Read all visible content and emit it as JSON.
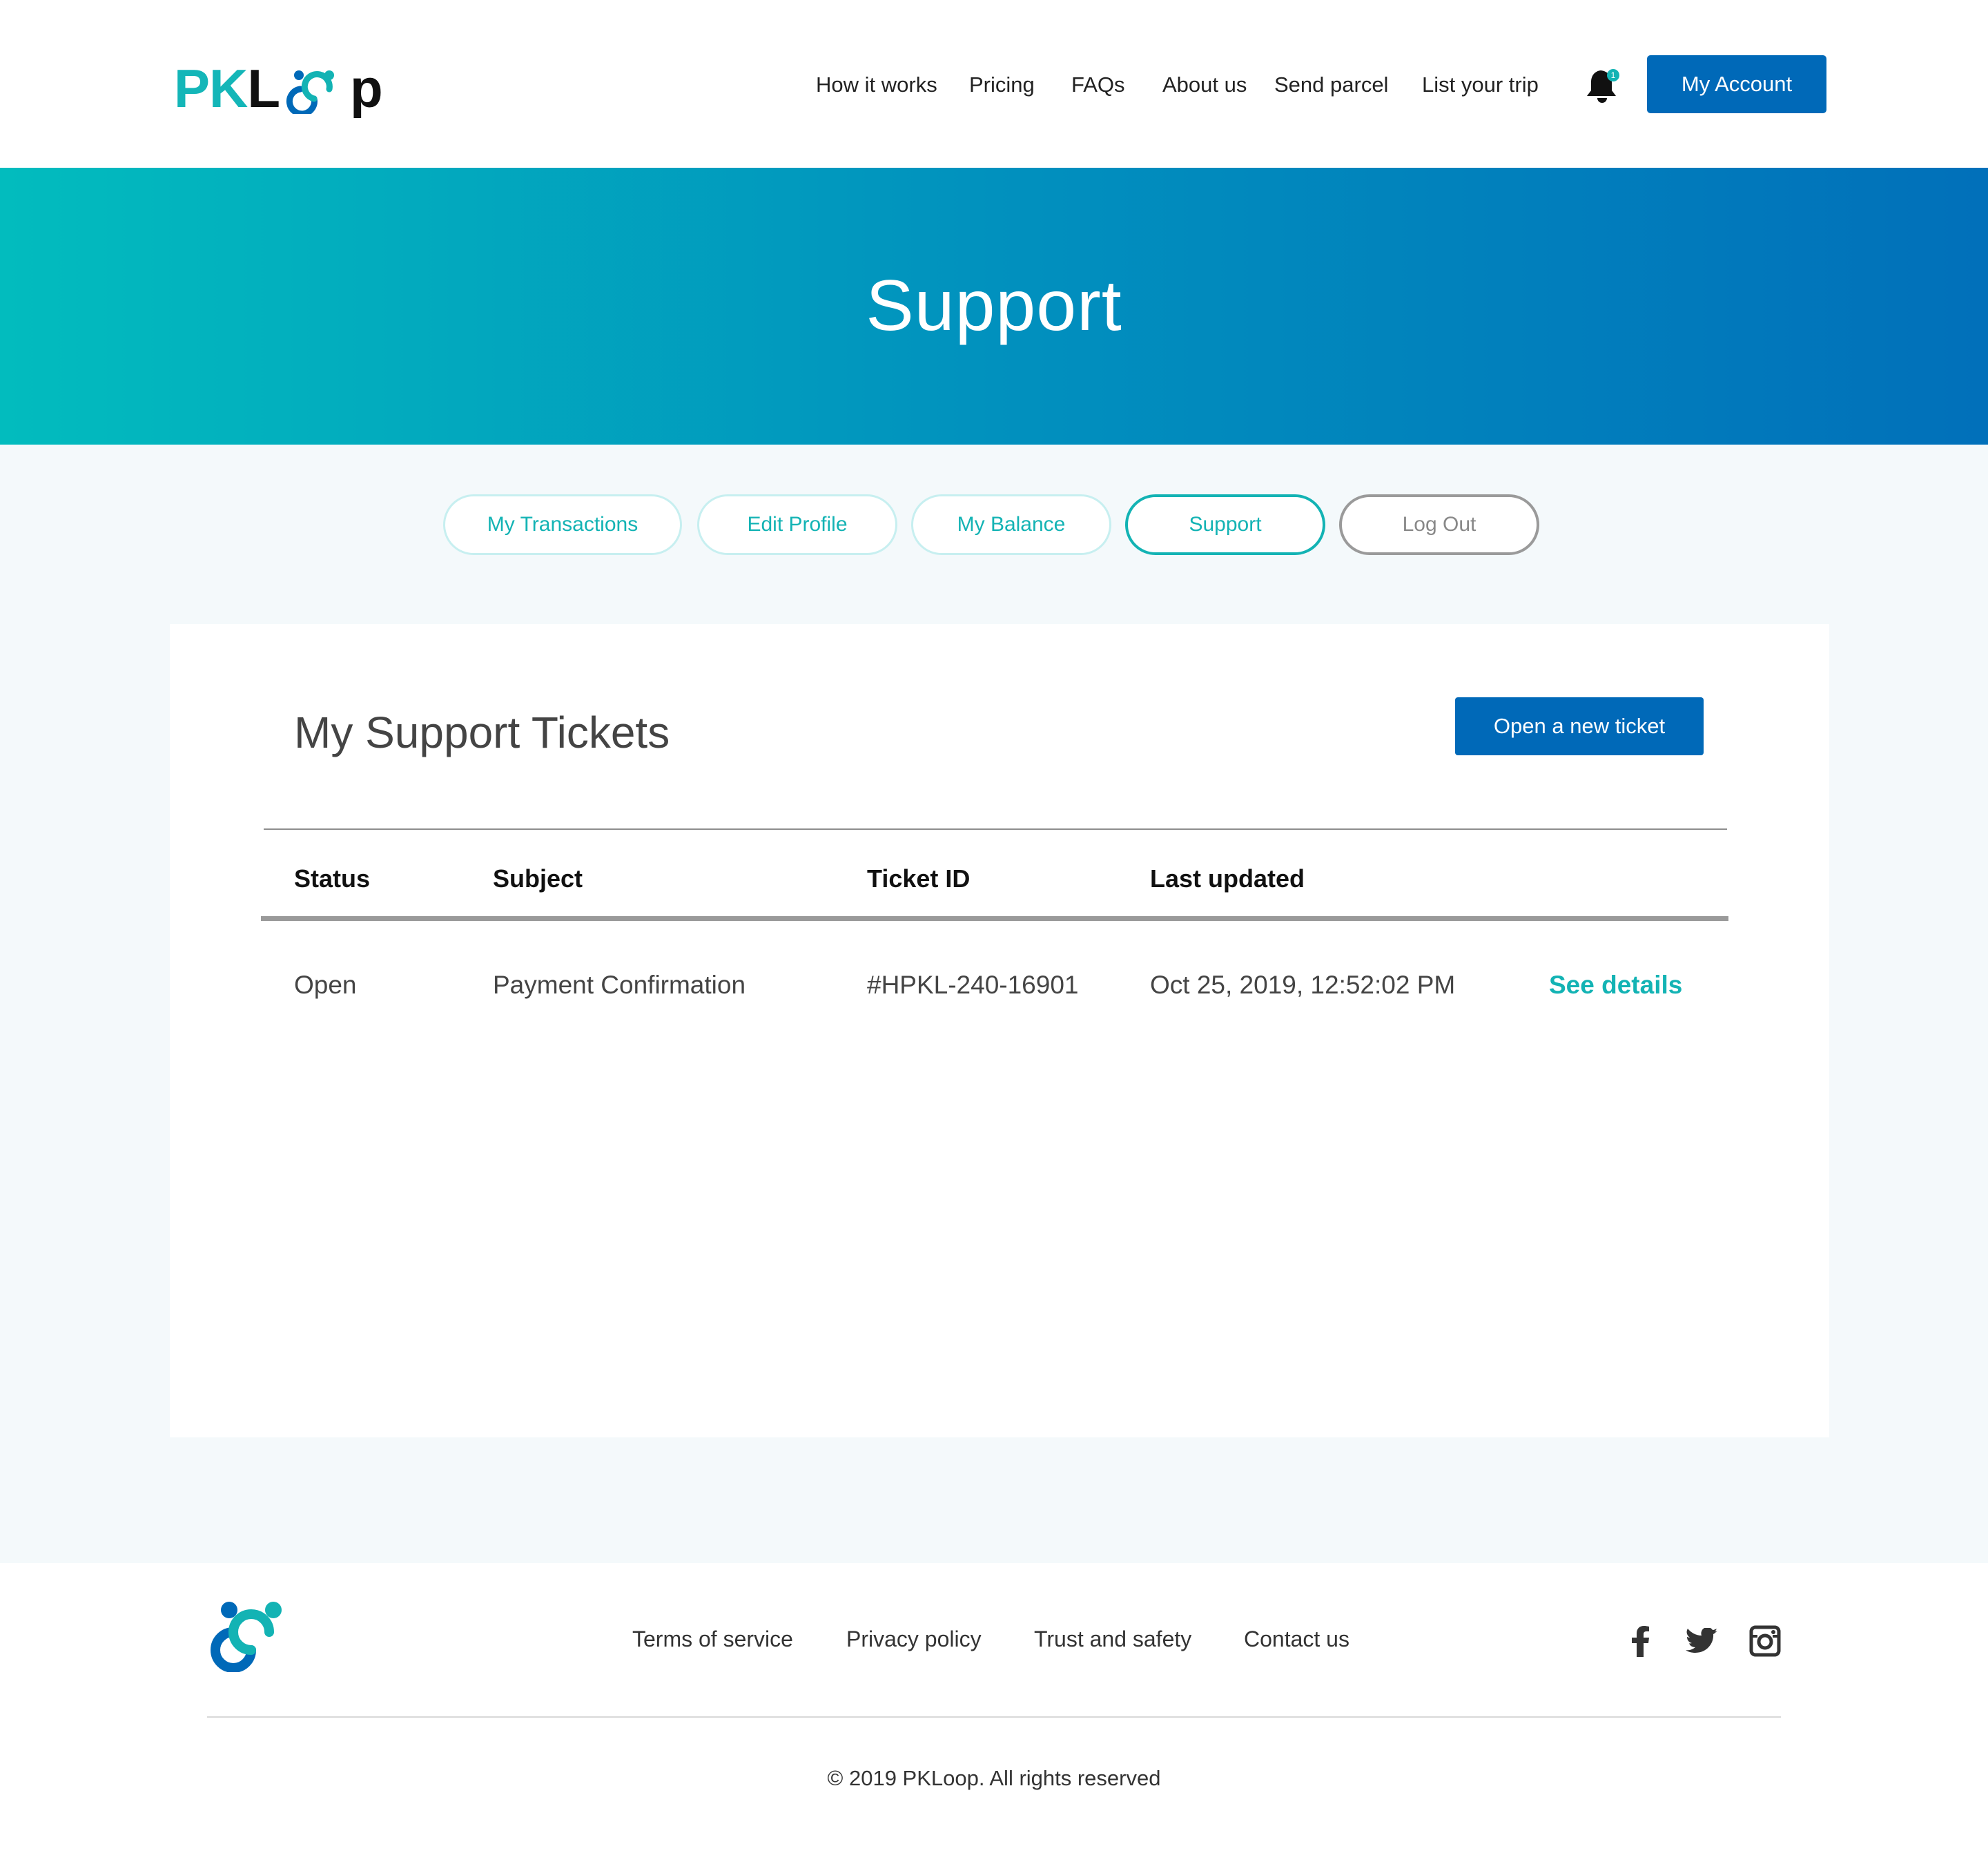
{
  "header": {
    "logo": {
      "part1": "PK",
      "part2": "L",
      "part3": "p"
    },
    "nav": [
      "How it works",
      "Pricing",
      "FAQs",
      "About us",
      "Send parcel",
      "List your trip"
    ],
    "notification_count": "1",
    "account_label": "My Account"
  },
  "hero": {
    "title": "Support"
  },
  "tabs": [
    {
      "label": "My Transactions"
    },
    {
      "label": "Edit Profile"
    },
    {
      "label": "My Balance"
    },
    {
      "label": "Support"
    },
    {
      "label": "Log Out"
    }
  ],
  "tickets": {
    "title": "My Support Tickets",
    "new_ticket_label": "Open a new ticket",
    "columns": [
      "Status",
      "Subject",
      "Ticket ID",
      "Last updated"
    ],
    "rows": [
      {
        "status": "Open",
        "subject": "Payment Confirmation",
        "ticket_id": "#HPKL-240-16901",
        "last_updated": "Oct 25, 2019, 12:52:02 PM",
        "action": "See details"
      }
    ]
  },
  "footer": {
    "links": [
      "Terms of service",
      "Privacy policy",
      "Trust and safety",
      "Contact us"
    ],
    "social": [
      "facebook-icon",
      "twitter-icon",
      "instagram-icon"
    ],
    "copyright": "© 2019 PKLoop. All rights reserved"
  },
  "colors": {
    "brand_teal": "#13b3b4",
    "brand_blue": "#0069b8",
    "hero_gradient_start": "#02bcbe",
    "hero_gradient_end": "#0170ba"
  }
}
